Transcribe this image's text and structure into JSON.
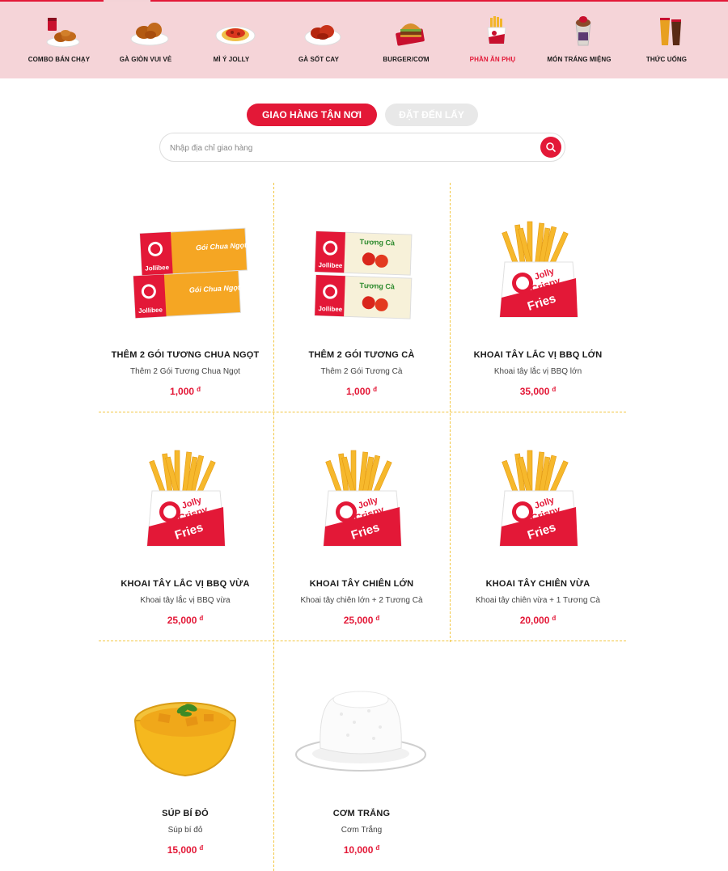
{
  "categories": [
    {
      "label": "COMBO BÁN CHẠY",
      "icon": "combo-meal-icon",
      "active": false
    },
    {
      "label": "GÀ GIÒN VUI VẺ",
      "icon": "fried-chicken-icon",
      "active": false
    },
    {
      "label": "MÌ Ý JOLLY",
      "icon": "spaghetti-icon",
      "active": false
    },
    {
      "label": "GÀ SỐT CAY",
      "icon": "spicy-chicken-icon",
      "active": false
    },
    {
      "label": "BURGER/CƠM",
      "icon": "burger-icon",
      "active": false
    },
    {
      "label": "PHẦN ĂN PHỤ",
      "icon": "fries-icon",
      "active": true
    },
    {
      "label": "MÓN TRÁNG MIỆNG",
      "icon": "dessert-icon",
      "active": false
    },
    {
      "label": "THỨC UỐNG",
      "icon": "drinks-icon",
      "active": false
    }
  ],
  "order_mode": {
    "delivery_label": "GIAO HÀNG TẬN NƠI",
    "pickup_label": "ĐẶT ĐẾN LẤY",
    "selected": "delivery"
  },
  "search": {
    "placeholder": "Nhập địa chỉ giao hàng",
    "value": ""
  },
  "currency_symbol": "đ",
  "products": [
    {
      "name": "THÊM 2 GÓI TƯƠNG CHUA NGỌT",
      "description": "Thêm 2 Gói Tương Chua Ngọt",
      "price": "1,000",
      "image": "sweet-sour-sauce-packets-image"
    },
    {
      "name": "THÊM 2 GÓI TƯƠNG CÀ",
      "description": "Thêm 2 Gói Tương Cà",
      "price": "1,000",
      "image": "ketchup-packets-image"
    },
    {
      "name": "KHOAI TÂY LẮC VỊ BBQ LỚN",
      "description": "Khoai tây lắc vị BBQ lớn",
      "price": "35,000",
      "image": "fries-image"
    },
    {
      "name": "KHOAI TÂY LẮC VỊ BBQ VỪA",
      "description": "Khoai tây lắc vị BBQ vừa",
      "price": "25,000",
      "image": "fries-image"
    },
    {
      "name": "KHOAI TÂY CHIÊN LỚN",
      "description": "Khoai tây chiên lớn + 2 Tương Cà",
      "price": "25,000",
      "image": "fries-image"
    },
    {
      "name": "KHOAI TÂY CHIÊN VỪA",
      "description": "Khoai tây chiên vừa + 1 Tương Cà",
      "price": "20,000",
      "image": "fries-image"
    },
    {
      "name": "SÚP BÍ ĐỎ",
      "description": "Súp bí đỏ",
      "price": "15,000",
      "image": "pumpkin-soup-image"
    },
    {
      "name": "CƠM TRẮNG",
      "description": "Cơm Trắng",
      "price": "10,000",
      "image": "white-rice-image"
    }
  ],
  "packet_labels": {
    "brand": "Jollibee",
    "sweet_sour": "Gói Chua Ngọt",
    "ketchup": "Tương Cà"
  },
  "fries_box_text": [
    "Jolly",
    "Crispy",
    "Fries"
  ],
  "colors": {
    "brand_red": "#e31837",
    "category_bar": "#f5d4d8",
    "grid_dash": "#f2c744",
    "pickup_button": "#e8e8e8"
  }
}
